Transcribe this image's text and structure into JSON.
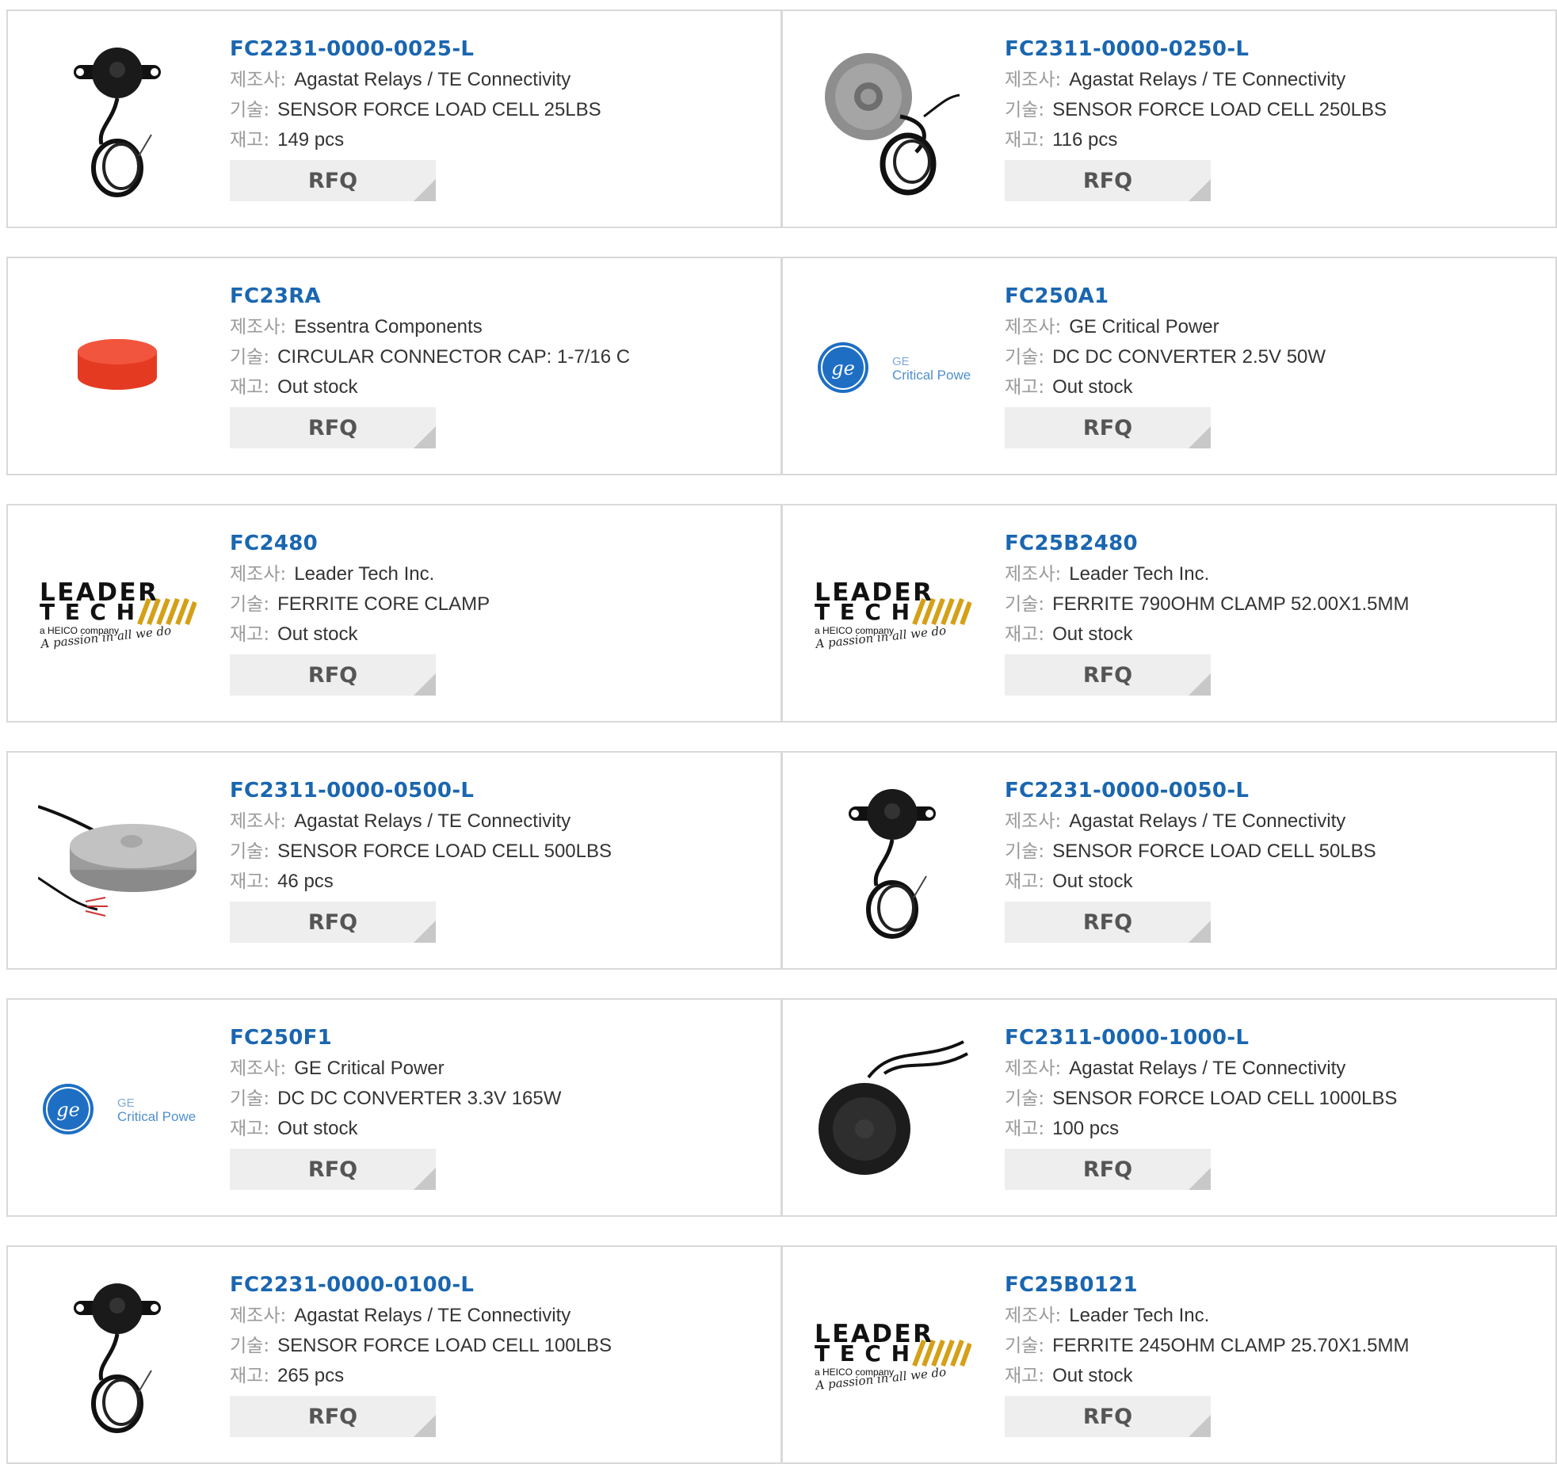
{
  "labels": {
    "manufacturer": "제조사",
    "description": "기술",
    "stock": "재고",
    "separator": ":"
  },
  "colors": {
    "link": "#1a66b0",
    "border": "#d9d9d9",
    "button_bg": "#eeeeee",
    "ge_blue": "#1e6fc4",
    "leader_gold": "#d4a017"
  },
  "products": [
    {
      "part": "FC2231-0000-0025-L",
      "manufacturer": "Agastat Relays / TE Connectivity",
      "description": "SENSOR FORCE LOAD CELL 25LBS",
      "stock": "149 pcs",
      "image": "load-cell-small",
      "rfq": "RFQ"
    },
    {
      "part": "FC2311-0000-0250-L",
      "manufacturer": "Agastat Relays / TE Connectivity",
      "description": "SENSOR FORCE LOAD CELL 250LBS",
      "stock": "116 pcs",
      "image": "load-cell-disc",
      "rfq": "RFQ"
    },
    {
      "part": "FC23RA",
      "manufacturer": "Essentra Components",
      "description": "CIRCULAR CONNECTOR CAP: 1-7/16 C",
      "stock": "Out stock",
      "image": "red-cap",
      "rfq": "RFQ"
    },
    {
      "part": "FC250A1",
      "manufacturer": "GE Critical Power",
      "description": "DC DC CONVERTER 2.5V 50W",
      "stock": "Out stock",
      "image": "ge-logo",
      "logo_text": [
        "GE",
        "Critical Power"
      ],
      "rfq": "RFQ"
    },
    {
      "part": "FC2480",
      "manufacturer": "Leader Tech Inc.",
      "description": "FERRITE CORE CLAMP",
      "stock": "Out stock",
      "image": "leader-tech-logo",
      "logo_text": [
        "LEADER",
        "TECH",
        "a HEICO company",
        "A passion in all we do"
      ],
      "rfq": "RFQ"
    },
    {
      "part": "FC25B2480",
      "manufacturer": "Leader Tech Inc.",
      "description": "FERRITE 790OHM CLAMP 52.00X1.5MM",
      "stock": "Out stock",
      "image": "leader-tech-logo",
      "logo_text": [
        "LEADER",
        "TECH",
        "a HEICO company",
        "A passion in all we do"
      ],
      "rfq": "RFQ"
    },
    {
      "part": "FC2311-0000-0500-L",
      "manufacturer": "Agastat Relays / TE Connectivity",
      "description": "SENSOR FORCE LOAD CELL 500LBS",
      "stock": "46 pcs",
      "image": "load-cell-steel",
      "rfq": "RFQ"
    },
    {
      "part": "FC2231-0000-0050-L",
      "manufacturer": "Agastat Relays / TE Connectivity",
      "description": "SENSOR FORCE LOAD CELL 50LBS",
      "stock": "Out stock",
      "image": "load-cell-small",
      "rfq": "RFQ"
    },
    {
      "part": "FC250F1",
      "manufacturer": "GE Critical Power",
      "description": "DC DC CONVERTER 3.3V 165W",
      "stock": "Out stock",
      "image": "ge-logo",
      "logo_text": [
        "GE",
        "Critical Power"
      ],
      "rfq": "RFQ"
    },
    {
      "part": "FC2311-0000-1000-L",
      "manufacturer": "Agastat Relays / TE Connectivity",
      "description": "SENSOR FORCE LOAD CELL 1000LBS",
      "stock": "100 pcs",
      "image": "load-cell-black-disc",
      "rfq": "RFQ"
    },
    {
      "part": "FC2231-0000-0100-L",
      "manufacturer": "Agastat Relays / TE Connectivity",
      "description": "SENSOR FORCE LOAD CELL 100LBS",
      "stock": "265 pcs",
      "image": "load-cell-small",
      "rfq": "RFQ"
    },
    {
      "part": "FC25B0121",
      "manufacturer": "Leader Tech Inc.",
      "description": "FERRITE 245OHM CLAMP 25.70X1.5MM",
      "stock": "Out stock",
      "image": "leader-tech-logo",
      "logo_text": [
        "LEADER",
        "TECH",
        "a HEICO company",
        "A passion in all we do"
      ],
      "rfq": "RFQ"
    }
  ]
}
